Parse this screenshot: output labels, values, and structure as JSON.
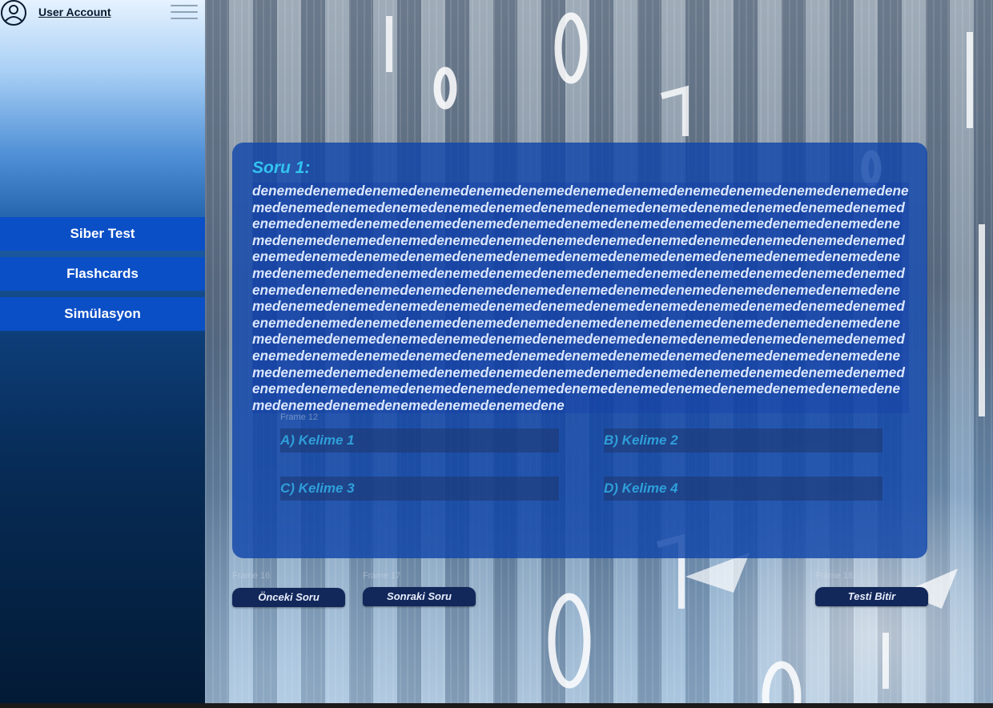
{
  "sidebar": {
    "user_account": "User Account",
    "items": [
      {
        "label": "Siber Test"
      },
      {
        "label": "Flashcards"
      },
      {
        "label": "Simülasyon"
      }
    ]
  },
  "question": {
    "title": "Soru 1:",
    "text": "denemedenemedenemedenemedenemedenemedenemedenemedenemedenemedenemedenemedenemedenemedenemedenemedenemedenemedenemedenemedenemedenemedenemedenemedenemedenemedenemedenemedenemedenemedenemedenemedenemedenemedenemedenemedenemedenemedenemedenemedenemedenemedenemedenemedenemedenemedenemedenemedenemedenemedenemedenemedenemedenemedenemedenemedenemedenemedenemedenemedenemedenemedenemedenemedenemedenemedenemedenemedenemedenemedenemedenemedenemedenemedenemedenemedenemedenemedenemedenemedenemedenemedenemedenemedenemedenemedenemedenemedenemedenemedenemedenemedenemedenemedenemedenemedenemedenemedenemedenemedenemedenemedenemedenemedenemedenemedenemedenemedenemedenemedenemedenemedenemedenemedenemedenemedenemedenemedenemedenemedenemedenemedenemedenemedenemedenemedenemedenemedenemedenemedenemedenemedenemedenemedenemedenemedenemedenemedenemedenemedenemedenemedenemedenemedenemedenemedenemedenemedenemedenemedenemedenemedenemedenemedenemedenemedenemedenemedenemedenemedenemedenemedenemedenemedenemedenemedenemedenemedene",
    "options_frame_label": "Frame 12",
    "options": {
      "a": "A) Kelime 1",
      "b": "B) Kelime 2",
      "c": "C) Kelime 3",
      "d": "D) Kelime 4"
    }
  },
  "footer": {
    "prev_frame_label": "Frame 16",
    "prev_label": "Önceki Soru",
    "next_frame_label": "Frame 17",
    "next_label": "Sonraki Soru",
    "finish_frame_label": "Frame 18",
    "finish_label": "Testi Bitir"
  },
  "colors": {
    "accent": "#33c4f0",
    "nav_item": "#0b4fc6",
    "card": "#1046aa",
    "button": "#12275a"
  },
  "icons": {
    "avatar": "user-circle-icon",
    "menu": "hamburger-menu-icon"
  }
}
